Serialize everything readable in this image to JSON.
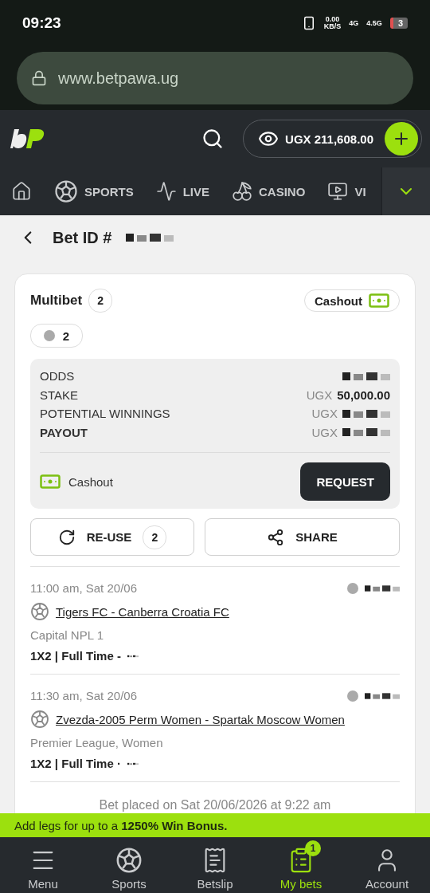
{
  "status_bar": {
    "time": "09:23",
    "speed": "0.00",
    "speed_unit": "KB/S",
    "network_1": "4G",
    "network_2": "4.5G",
    "battery": "3"
  },
  "browser": {
    "url": "www.betpawa.ug"
  },
  "header": {
    "balance": "UGX 211,608.00"
  },
  "nav": [
    {
      "kind": "home"
    },
    {
      "kind": "sports",
      "label": "SPORTS"
    },
    {
      "kind": "live",
      "label": "LIVE"
    },
    {
      "kind": "casino",
      "label": "CASINO"
    },
    {
      "kind": "virtual",
      "label": "VI"
    }
  ],
  "bet": {
    "title": "Bet ID #",
    "type": "Multibet",
    "legs_count": "2",
    "cashout_badge": "Cashout",
    "status_count": "2",
    "summary": [
      {
        "label": "ODDS",
        "bold": false
      },
      {
        "label": "STAKE",
        "bold": false,
        "currency": "UGX",
        "amount": "50,000.00"
      },
      {
        "label": "POTENTIAL WINNINGS",
        "bold": false,
        "currency": "UGX"
      },
      {
        "label": "PAYOUT",
        "bold": true,
        "currency": "UGX"
      }
    ],
    "cashout_label": "Cashout",
    "request_button": "REQUEST",
    "reuse_button": "RE-USE",
    "reuse_count": "2",
    "share_button": "SHARE",
    "legs": [
      {
        "time": "11:00 am, Sat 20/06",
        "match": "Tigers FC - Canberra Croatia FC",
        "league": "Capital NPL 1",
        "market": "1X2 | Full Time -"
      },
      {
        "time": "11:30 am, Sat 20/06",
        "match": "Zvezda-2005 Perm Women - Spartak Moscow Women",
        "league": "Premier League, Women",
        "market": "1X2 | Full Time ·"
      }
    ],
    "placed": "Bet placed on Sat 20/06/2026 at 9:22 am"
  },
  "banner": "Add legs for up to a **1250% Win Bonus.**",
  "bottom_nav": [
    {
      "kind": "menu",
      "label": "Menu",
      "selected": false
    },
    {
      "kind": "sports",
      "label": "Sports",
      "selected": false
    },
    {
      "kind": "betslip",
      "label": "Betslip",
      "selected": false
    },
    {
      "kind": "mybets",
      "label": "My bets",
      "selected": true,
      "badge": "1"
    },
    {
      "kind": "account",
      "label": "Account",
      "selected": false
    }
  ]
}
